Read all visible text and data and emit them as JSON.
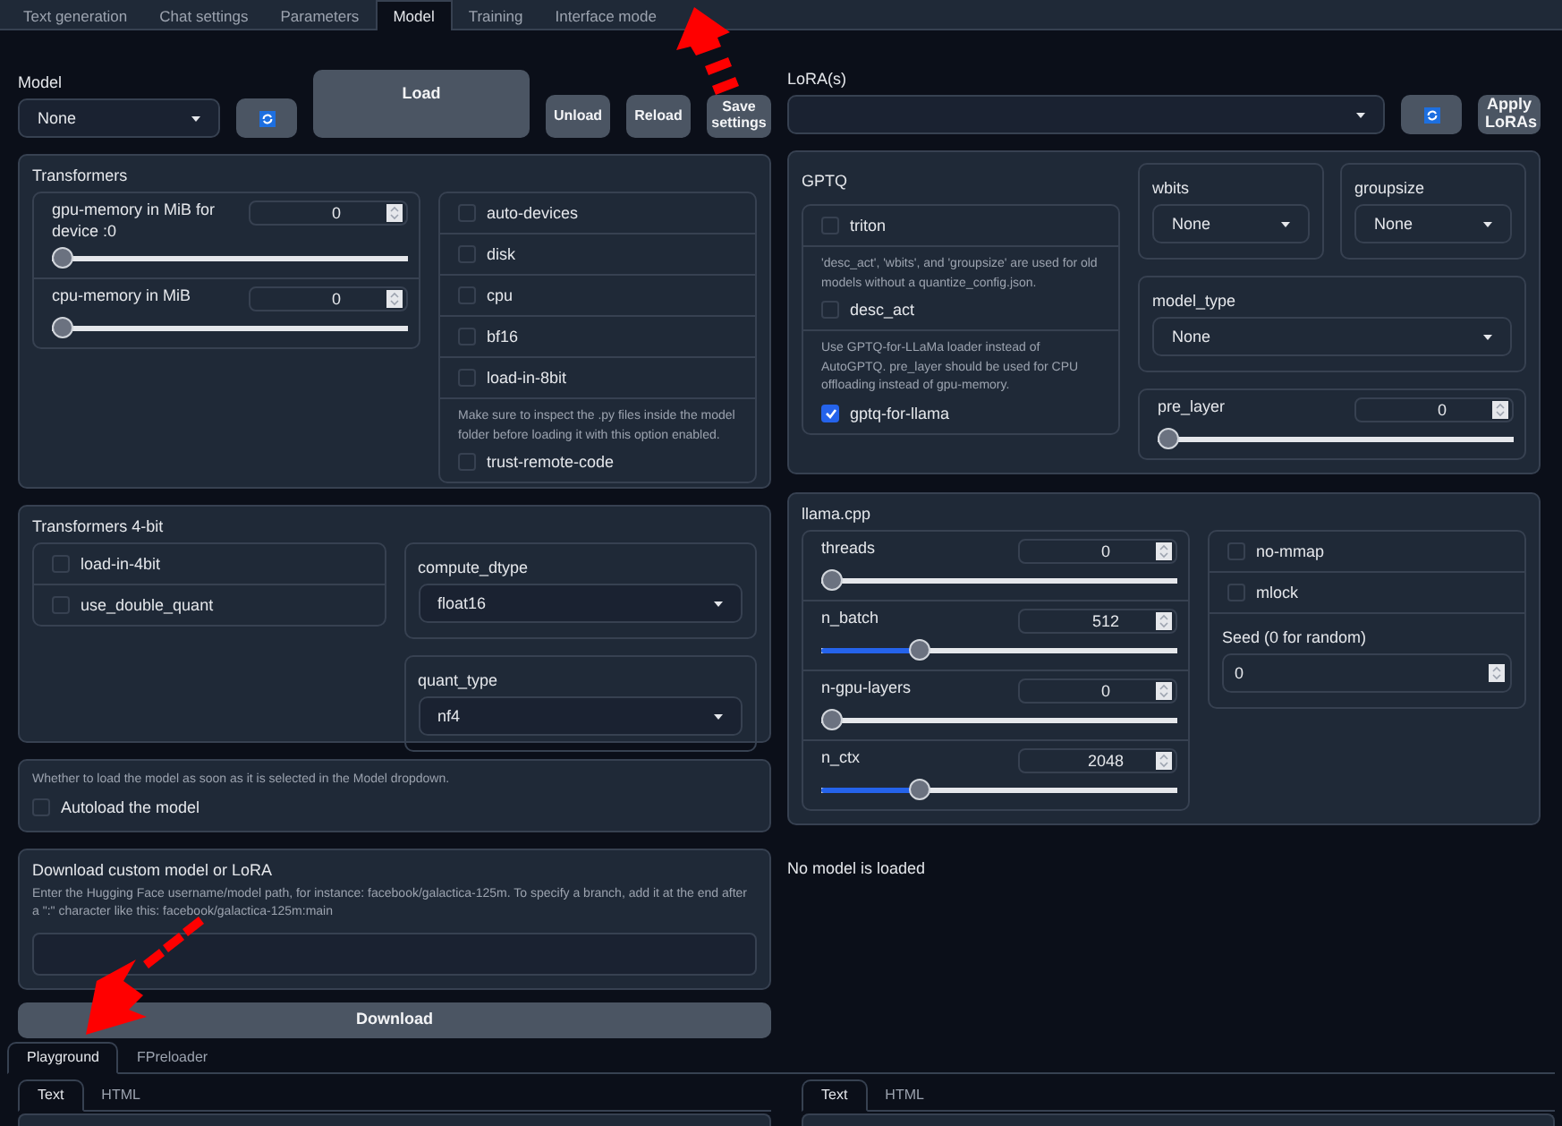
{
  "tabs": [
    {
      "label": "Text generation",
      "selected": false
    },
    {
      "label": "Chat settings",
      "selected": false
    },
    {
      "label": "Parameters",
      "selected": false
    },
    {
      "label": "Model",
      "selected": true
    },
    {
      "label": "Training",
      "selected": false
    },
    {
      "label": "Interface mode",
      "selected": false
    }
  ],
  "model": {
    "label": "Model",
    "value": "None",
    "load_button": "Load",
    "buttons": [
      "Unload",
      "Reload",
      "Save settings"
    ]
  },
  "lora": {
    "label": "LoRA(s)",
    "apply_button": "Apply LoRAs"
  },
  "transformers": {
    "title": "Transformers",
    "sliders": [
      {
        "label": "gpu-memory in MiB for device :0",
        "value": "0",
        "level": 0
      },
      {
        "label": "cpu-memory in MiB",
        "value": "0",
        "level": 0
      }
    ],
    "options": [
      {
        "label": "auto-devices",
        "checked": false
      },
      {
        "label": "disk",
        "checked": false
      },
      {
        "label": "cpu",
        "checked": false
      },
      {
        "label": "bf16",
        "checked": false
      },
      {
        "label": "load-in-8bit",
        "checked": false
      },
      {
        "note": "Make sure to inspect the .py files inside the model folder before loading it with this option enabled.",
        "label": "trust-remote-code",
        "checked": false
      }
    ]
  },
  "transformers_4bit": {
    "title": "Transformers 4-bit",
    "options": [
      {
        "label": "load-in-4bit",
        "checked": false
      },
      {
        "label": "use_double_quant",
        "checked": false
      }
    ],
    "dropdowns": [
      {
        "label": "compute_dtype",
        "value": "float16"
      },
      {
        "label": "quant_type",
        "value": "nf4"
      }
    ]
  },
  "autoload": {
    "note": "Whether to load the model as soon as it is selected in the Model dropdown.",
    "label": "Autoload the model",
    "checked": false
  },
  "download": {
    "title": "Download custom model or LoRA",
    "description": "Enter the Hugging Face username/model path, for instance: facebook/galactica-125m. To specify a branch, add it at the end after a \":\" character like this: facebook/galactica-125m:main",
    "button": "Download"
  },
  "gptq": {
    "title": "GPTQ",
    "options": [
      {
        "label": "triton",
        "checked": false
      },
      {
        "note": "'desc_act', 'wbits', and 'groupsize' are used for old models without a quantize_config.json.",
        "label": "desc_act",
        "checked": false
      },
      {
        "note": "Use GPTQ-for-LLaMa loader instead of AutoGPTQ. pre_layer should be used for CPU offloading instead of gpu-memory.",
        "label": "gptq-for-llama",
        "checked": true
      }
    ],
    "wbits": {
      "label": "wbits",
      "value": "None"
    },
    "groupsize": {
      "label": "groupsize",
      "value": "None"
    },
    "model_type": {
      "label": "model_type",
      "value": "None"
    },
    "pre_layer": {
      "label": "pre_layer",
      "value": "0",
      "level": 0
    }
  },
  "llama_cpp": {
    "title": "llama.cpp",
    "sliders": [
      {
        "label": "threads",
        "value": "0",
        "level": 0
      },
      {
        "label": "n_batch",
        "value": "512",
        "level": 0.26
      },
      {
        "label": "n-gpu-layers",
        "value": "0",
        "level": 0
      },
      {
        "label": "n_ctx",
        "value": "2048",
        "level": 0.26
      }
    ],
    "options": [
      {
        "label": "no-mmap",
        "checked": false
      },
      {
        "label": "mlock",
        "checked": false
      }
    ],
    "seed": {
      "label": "Seed (0 for random)",
      "value": "0"
    }
  },
  "status": "No model is loaded",
  "bottom_tabs": [
    {
      "label": "Playground",
      "selected": true
    },
    {
      "label": "FPreloader",
      "selected": false
    }
  ],
  "output_tabs_left": [
    {
      "label": "Text",
      "selected": true
    },
    {
      "label": "HTML",
      "selected": false
    }
  ],
  "output_tabs_right": [
    {
      "label": "Text",
      "selected": true
    },
    {
      "label": "HTML",
      "selected": false
    }
  ]
}
